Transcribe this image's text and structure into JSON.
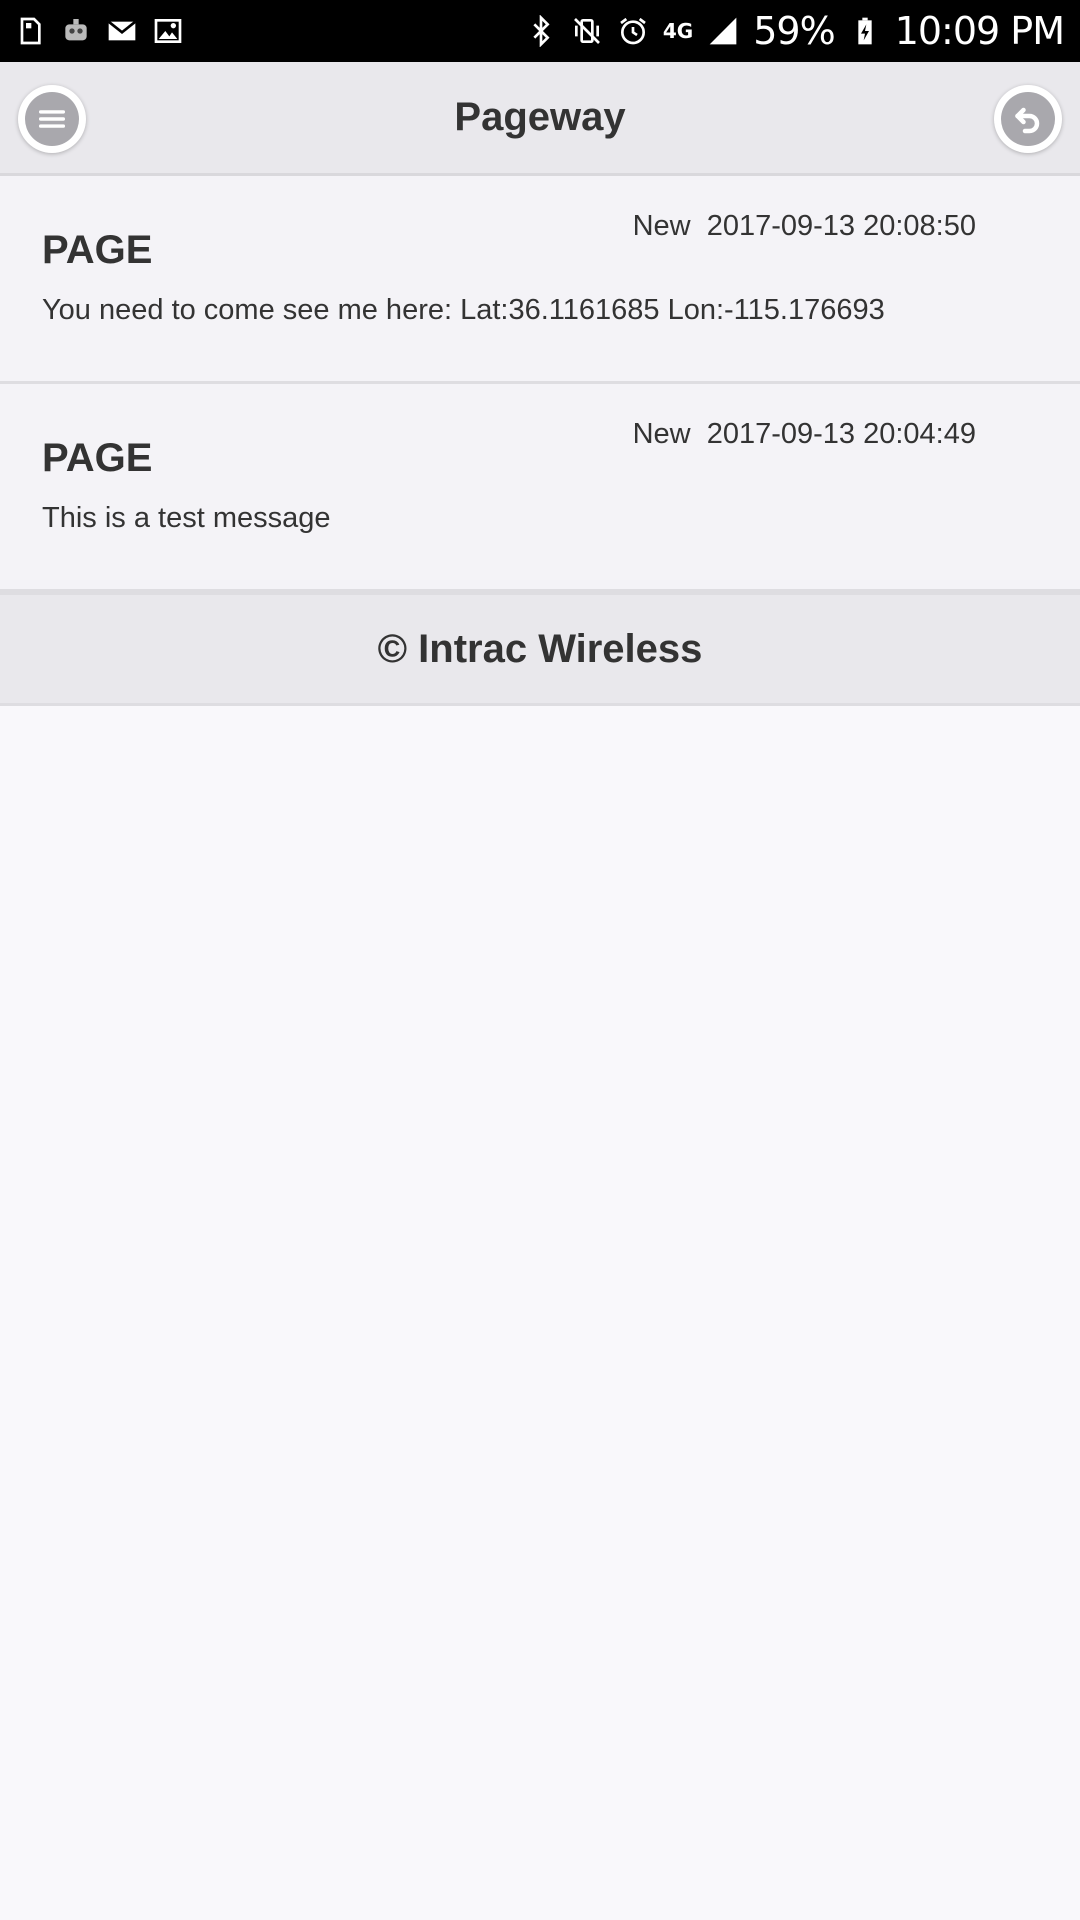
{
  "status_bar": {
    "left_icons": [
      "sim-card-icon",
      "robot-app-icon",
      "mail-icon",
      "image-icon"
    ],
    "right_icons": [
      "bluetooth-icon",
      "vibrate-icon",
      "alarm-icon",
      "network-4g-lte-icon",
      "signal-icon",
      "battery-charging-icon"
    ],
    "network_label": "4G",
    "battery": "59%",
    "time": "10:09 PM"
  },
  "header": {
    "title": "Pageway",
    "menu_icon": "menu-icon",
    "back_icon": "back-icon"
  },
  "messages": [
    {
      "title": "PAGE",
      "status": "New",
      "timestamp": "2017-09-13 20:08:50",
      "body": "You need to come see me here: Lat:36.1161685 Lon:-115.176693"
    },
    {
      "title": "PAGE",
      "status": "New",
      "timestamp": "2017-09-13 20:04:49",
      "body": "This is a test message"
    }
  ],
  "footer": {
    "text": "© Intrac Wireless"
  },
  "colors": {
    "status_bar": "#000000",
    "header_bg": "#e9e8ec",
    "list_bg": "#f4f3f7",
    "page_bg": "#f9f8fb",
    "button_gray": "#a9a8ad",
    "text": "#333333"
  }
}
